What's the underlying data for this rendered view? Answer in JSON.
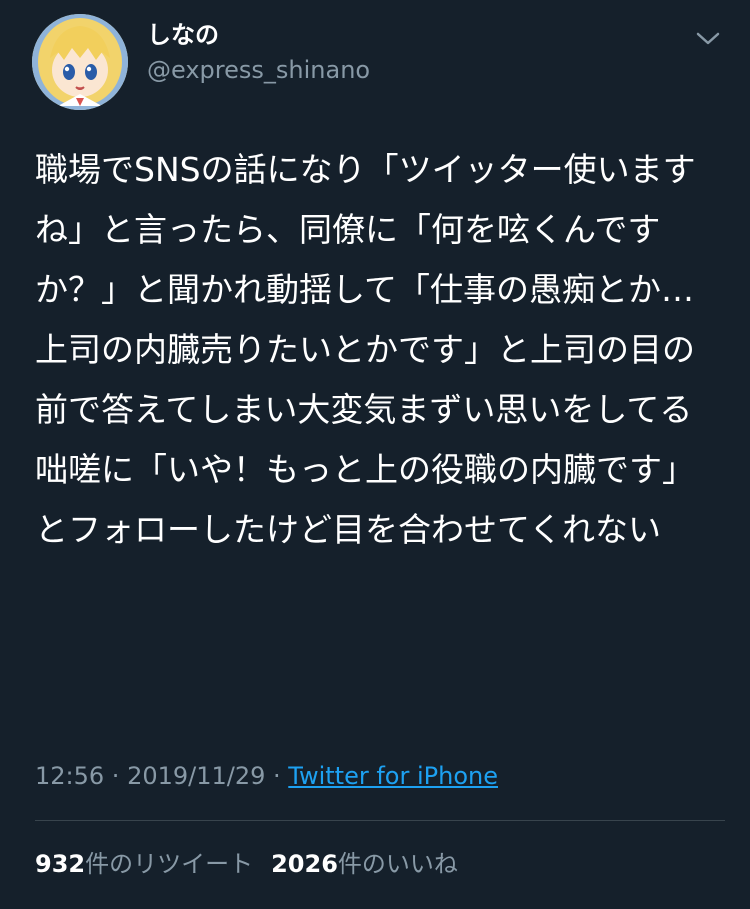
{
  "tweet": {
    "display_name": "しなの",
    "handle": "@express_shinano",
    "text": "職場でSNSの話になり「ツイッター使いますね」と言ったら、同僚に「何を呟くんですか？」と聞かれ動揺して「仕事の愚痴とか…上司の内臓売りたいとかです」と上司の目の前で答えてしまい大変気まずい思いをしてる 咄嗟に「いや！もっと上の役職の内臓です」とフォローしたけど目を合わせてくれない",
    "time": "12:56",
    "date": "2019/11/29",
    "separator": " · ",
    "source": "Twitter for iPhone",
    "retweets": {
      "count": "932",
      "label": "件のリツイート"
    },
    "likes": {
      "count": "2026",
      "label": "件のいいね"
    }
  },
  "icons": {
    "avatar": "anime-girl-avatar",
    "menu": "chevron-down-icon"
  },
  "colors": {
    "background": "#15202b",
    "primary_text": "#ffffff",
    "secondary_text": "#8899a6",
    "link": "#1da1f2",
    "divider": "#38444d"
  }
}
